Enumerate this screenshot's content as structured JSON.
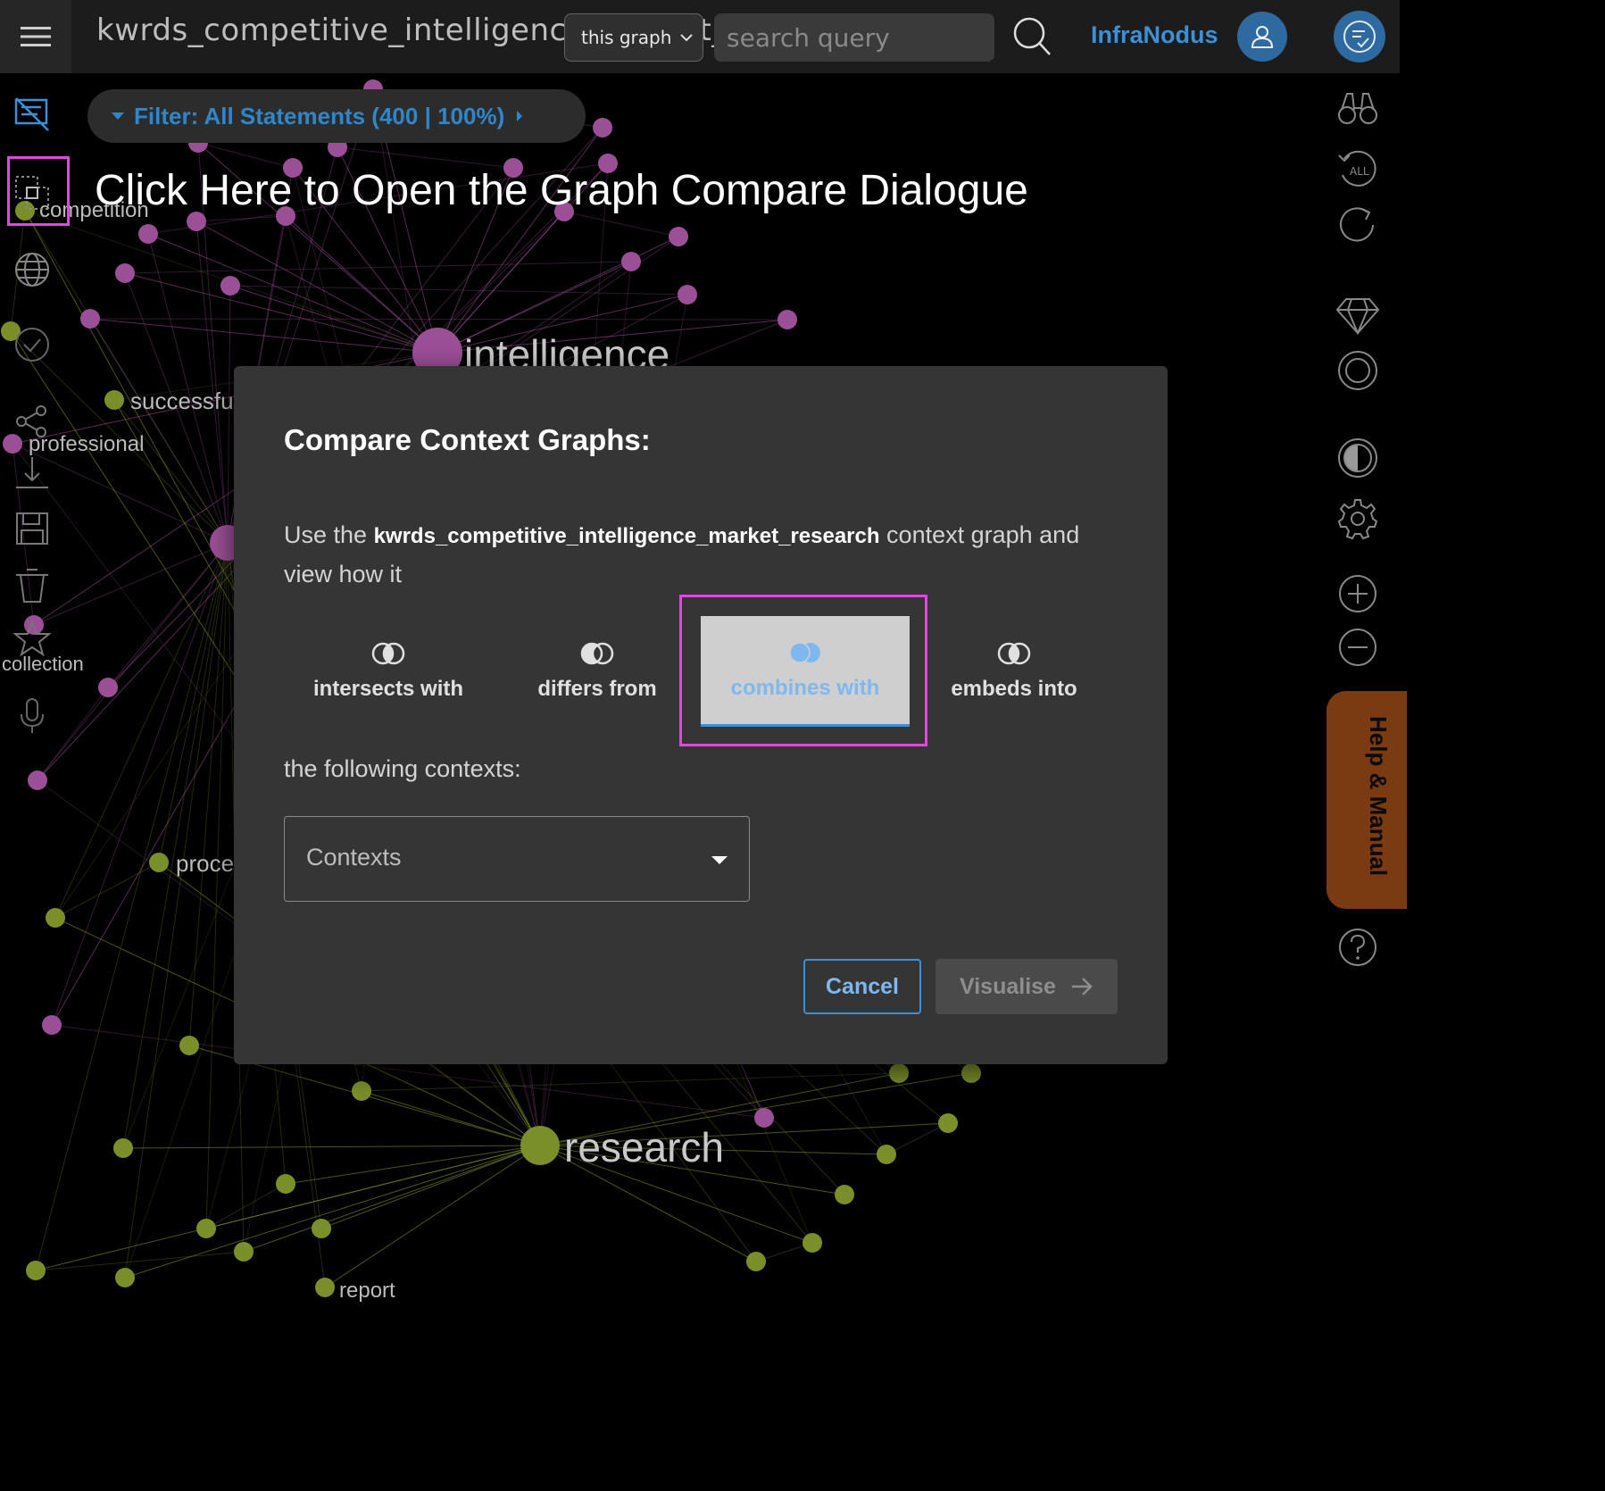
{
  "header": {
    "graph_title": "kwrds_competitive_intelligence_market_research",
    "scope_select": "this graph",
    "search_placeholder": "search query",
    "brand": "InfraNodus"
  },
  "filter": {
    "label": "Filter: All Statements (400 | 100%)"
  },
  "tooltip": {
    "text": "Click Here to Open the Graph Compare Dialogue"
  },
  "graph_labels": {
    "intelligence": "intelligence",
    "research": "research",
    "competition": "competition",
    "successful": "successful",
    "professional": "professional",
    "collection": "collection",
    "process": "proce",
    "report": "report"
  },
  "dialog": {
    "title": "Compare Context Graphs:",
    "body_prefix": "Use the",
    "body_graph": "kwrds_competitive_intelligence_market_research",
    "body_suffix": "context graph and view how it",
    "modes": [
      {
        "label": "intersects with",
        "active": false
      },
      {
        "label": "differs from",
        "active": false
      },
      {
        "label": "combines with",
        "active": true
      },
      {
        "label": "embeds into",
        "active": false
      }
    ],
    "subtitle": "the following contexts:",
    "contexts_placeholder": "Contexts",
    "cancel_label": "Cancel",
    "visualise_label": "Visualise"
  },
  "help_tab": {
    "label": "Help & Manual"
  },
  "colors": {
    "accent": "#3d8fd6",
    "highlight": "#e246e6",
    "node_purple": "#9b4f96",
    "node_green": "#7a8f2a",
    "help_tab": "#7a3a12"
  },
  "icons": {
    "left_rail": [
      "no-text-icon",
      "compare-icon",
      "globe-icon",
      "check-circle-icon",
      "share-icon",
      "save-icon",
      "trash-icon",
      "star-icon",
      "microphone-icon"
    ],
    "right_rail": [
      "binoculars-icon",
      "undo-all-icon",
      "refresh-icon",
      "gem-icon",
      "circle-icon",
      "contrast-icon",
      "gear-icon",
      "zoom-in-icon",
      "zoom-out-icon",
      "question-icon"
    ]
  }
}
